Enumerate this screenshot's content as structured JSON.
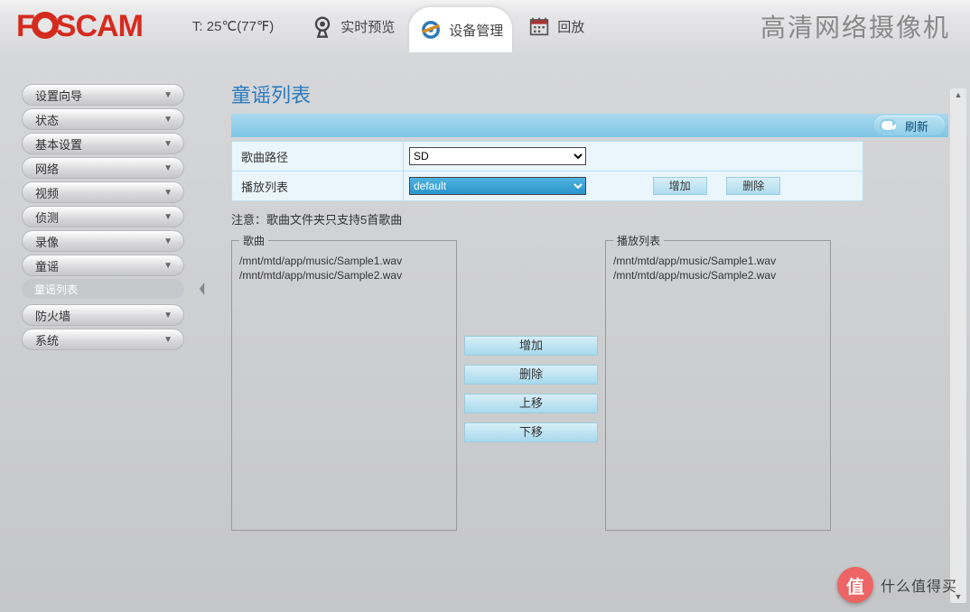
{
  "header": {
    "logo_text": "FOSCAM",
    "temperature": "T: 25℃(77℉)",
    "tabs": {
      "preview": "实时预览",
      "manage": "设备管理",
      "playback": "回放"
    },
    "title_right": "高清网络摄像机"
  },
  "sidebar": {
    "items": [
      "设置向导",
      "状态",
      "基本设置",
      "网络",
      "视频",
      "侦测",
      "录像",
      "童谣",
      "防火墙",
      "系统"
    ],
    "sub_item": "童谣列表"
  },
  "content": {
    "page_title": "童谣列表",
    "refresh_label": "刷新",
    "form": {
      "path_label": "歌曲路径",
      "path_value": "SD",
      "playlist_label": "播放列表",
      "playlist_value": "default",
      "add_btn": "增加",
      "del_btn": "删除"
    },
    "note": "注意：歌曲文件夹只支持5首歌曲",
    "songs_legend": "歌曲",
    "playlist_legend": "播放列表",
    "songs": [
      "/mnt/mtd/app/music/Sample1.wav",
      "/mnt/mtd/app/music/Sample2.wav"
    ],
    "playlist": [
      "/mnt/mtd/app/music/Sample1.wav",
      "/mnt/mtd/app/music/Sample2.wav"
    ],
    "mid_buttons": {
      "add": "增加",
      "delete": "删除",
      "up": "上移",
      "down": "下移"
    }
  },
  "watermark": {
    "icon": "值",
    "text": "什么值得买"
  }
}
